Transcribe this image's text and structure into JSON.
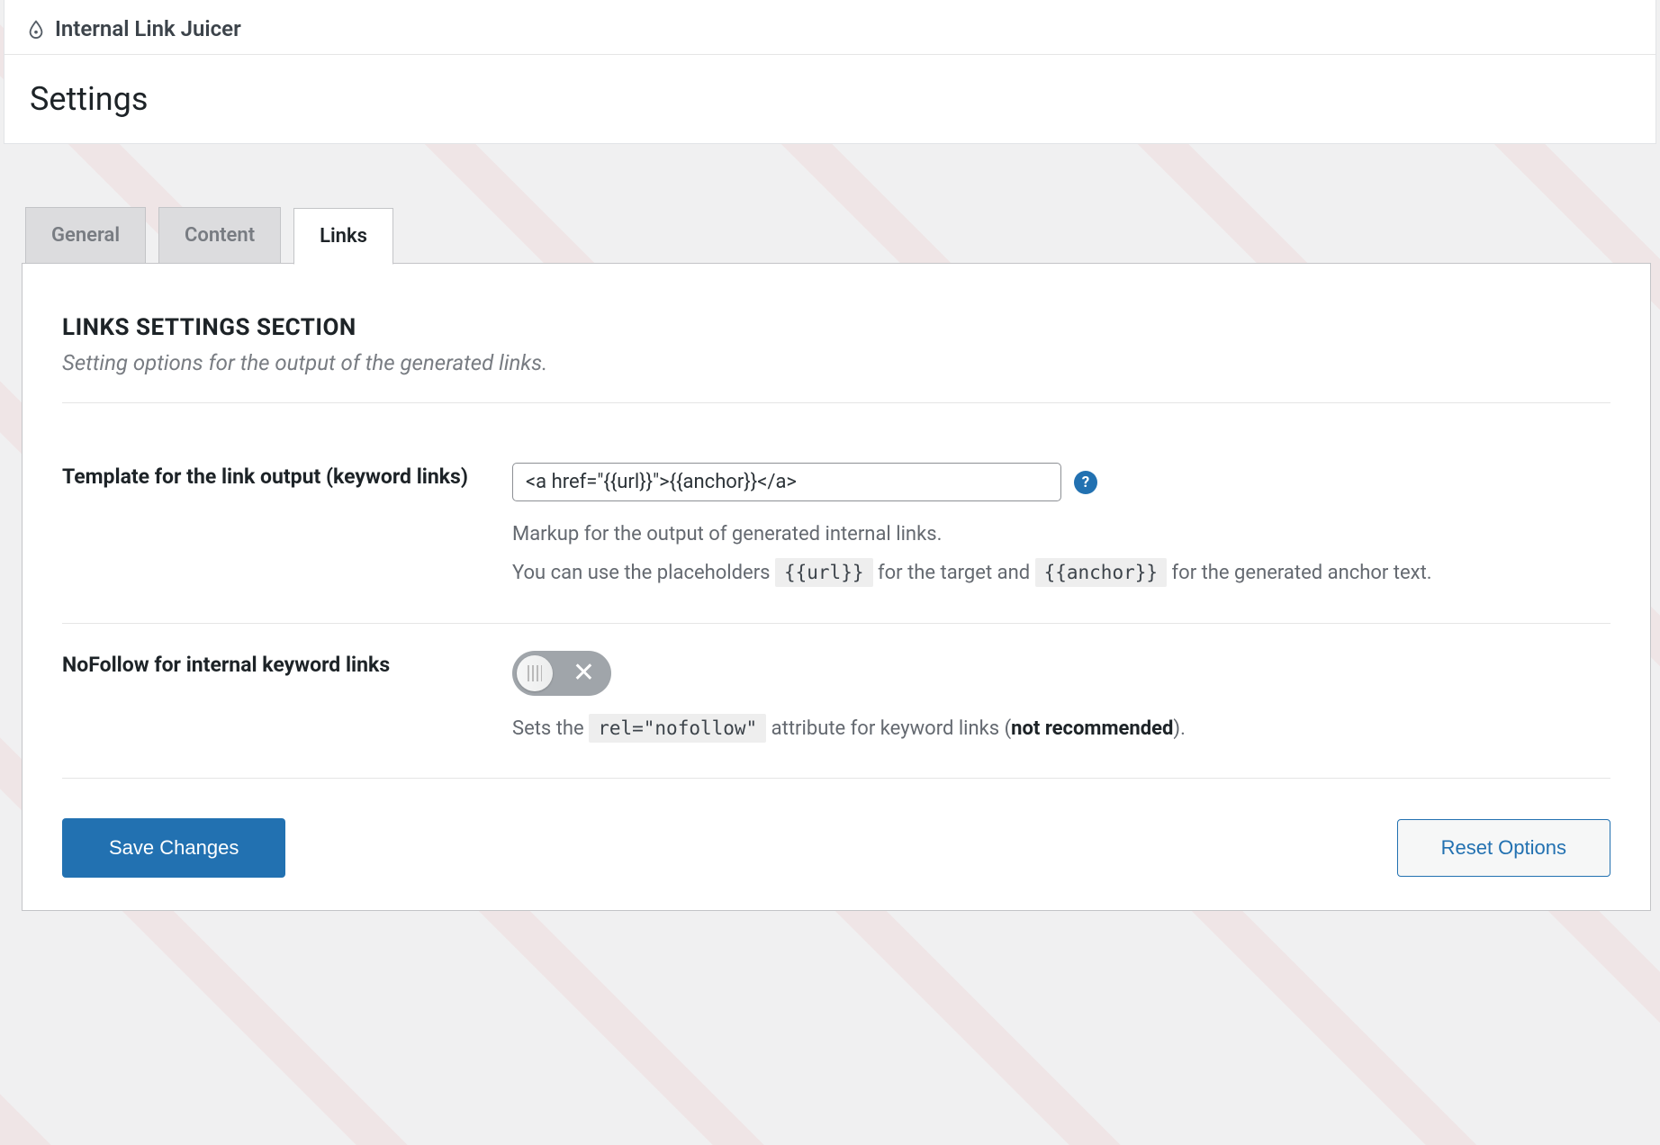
{
  "header": {
    "plugin_name": "Internal Link Juicer",
    "page_title": "Settings"
  },
  "tabs": [
    {
      "label": "General",
      "active": false
    },
    {
      "label": "Content",
      "active": false
    },
    {
      "label": "Links",
      "active": true
    }
  ],
  "section": {
    "title": "LINKS SETTINGS SECTION",
    "subtitle": "Setting options for the output of the generated links."
  },
  "settings": {
    "template": {
      "label": "Template for the link output (keyword links)",
      "value": "<a href=\"{{url}}\">{{anchor}}</a>",
      "desc_line1": "Markup for the output of generated internal links.",
      "desc_prefix": "You can use the placeholders ",
      "placeholder_url": "{{url}}",
      "desc_mid": " for the target and ",
      "placeholder_anchor": "{{anchor}}",
      "desc_suffix": " for the generated anchor text."
    },
    "nofollow": {
      "label": "NoFollow for internal keyword links",
      "enabled": false,
      "desc_prefix": "Sets the ",
      "code": "rel=\"nofollow\"",
      "desc_mid": " attribute for keyword links (",
      "strong": "not recommended",
      "desc_suffix": ")."
    }
  },
  "buttons": {
    "save": "Save Changes",
    "reset": "Reset Options"
  }
}
